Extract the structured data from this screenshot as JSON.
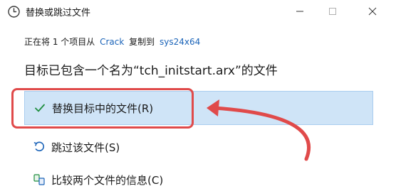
{
  "titlebar": {
    "title": "替换或跳过文件",
    "icon": "clock-icon",
    "controls": [
      "minimize-icon",
      "maximize-icon",
      "close-icon"
    ]
  },
  "copy_status": {
    "prefix": "正在将 1 个项目从",
    "source": "Crack",
    "middle": "复制到",
    "destination": "sys24x64"
  },
  "heading": "目标已包含一个名为“tch_initstart.arx”的文件",
  "options": [
    {
      "label": "替换目标中的文件(R)",
      "icon": "checkmark-icon"
    },
    {
      "label": "跳过该文件(S)",
      "icon": "skip-icon"
    },
    {
      "label": "比较两个文件的信息(C)",
      "icon": "compare-icon"
    }
  ],
  "colors": {
    "accent_link": "#1a63b8",
    "selected_bg": "#cfe4f7",
    "annotation_red": "#e04a4a",
    "check_green": "#1e8e3e"
  }
}
